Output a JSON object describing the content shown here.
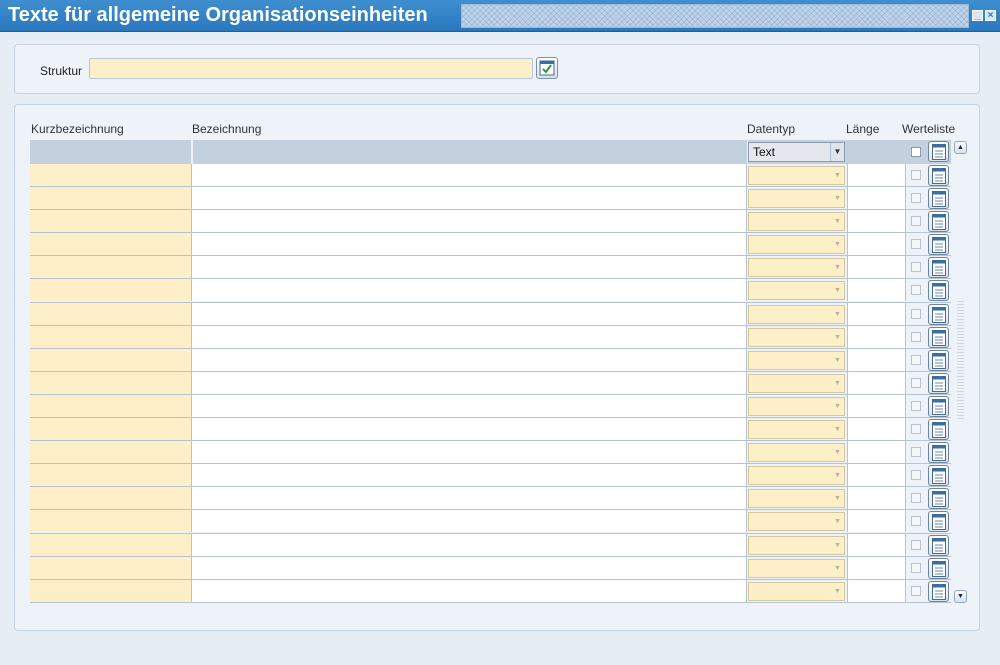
{
  "window": {
    "title": "Texte für allgemeine Organisationseinheiten"
  },
  "filter": {
    "struktur_label": "Struktur",
    "struktur_value": ""
  },
  "table": {
    "columns": {
      "kurz": "Kurzbezeichnung",
      "bez": "Bezeichnung",
      "datentyp": "Datentyp",
      "laenge": "Länge",
      "werteliste": "Werteliste"
    },
    "header_filter": {
      "datentyp_value": "Text"
    },
    "rows": [
      {
        "kurz": "",
        "bez": "",
        "datentyp": "",
        "laenge": ""
      },
      {
        "kurz": "",
        "bez": "",
        "datentyp": "",
        "laenge": ""
      },
      {
        "kurz": "",
        "bez": "",
        "datentyp": "",
        "laenge": ""
      },
      {
        "kurz": "",
        "bez": "",
        "datentyp": "",
        "laenge": ""
      },
      {
        "kurz": "",
        "bez": "",
        "datentyp": "",
        "laenge": ""
      },
      {
        "kurz": "",
        "bez": "",
        "datentyp": "",
        "laenge": ""
      },
      {
        "kurz": "",
        "bez": "",
        "datentyp": "",
        "laenge": ""
      },
      {
        "kurz": "",
        "bez": "",
        "datentyp": "",
        "laenge": ""
      },
      {
        "kurz": "",
        "bez": "",
        "datentyp": "",
        "laenge": ""
      },
      {
        "kurz": "",
        "bez": "",
        "datentyp": "",
        "laenge": ""
      },
      {
        "kurz": "",
        "bez": "",
        "datentyp": "",
        "laenge": ""
      },
      {
        "kurz": "",
        "bez": "",
        "datentyp": "",
        "laenge": ""
      },
      {
        "kurz": "",
        "bez": "",
        "datentyp": "",
        "laenge": ""
      },
      {
        "kurz": "",
        "bez": "",
        "datentyp": "",
        "laenge": ""
      },
      {
        "kurz": "",
        "bez": "",
        "datentyp": "",
        "laenge": ""
      },
      {
        "kurz": "",
        "bez": "",
        "datentyp": "",
        "laenge": ""
      },
      {
        "kurz": "",
        "bez": "",
        "datentyp": "",
        "laenge": ""
      },
      {
        "kurz": "",
        "bez": "",
        "datentyp": "",
        "laenge": ""
      },
      {
        "kurz": "",
        "bez": "",
        "datentyp": "",
        "laenge": ""
      }
    ]
  },
  "icons": {
    "minimize": "minimize-icon",
    "close": "close-icon",
    "struktur_button": "list-check-icon",
    "werteliste_button": "list-icon",
    "dropdown": "chevron-down-icon",
    "scroll_up": "arrow-up-icon",
    "scroll_down": "arrow-down-icon"
  },
  "colors": {
    "titlebar": "#2a77bd",
    "required_field": "#fdefc7",
    "panel": "#eef3f9",
    "header_row": "#c3d1df"
  }
}
